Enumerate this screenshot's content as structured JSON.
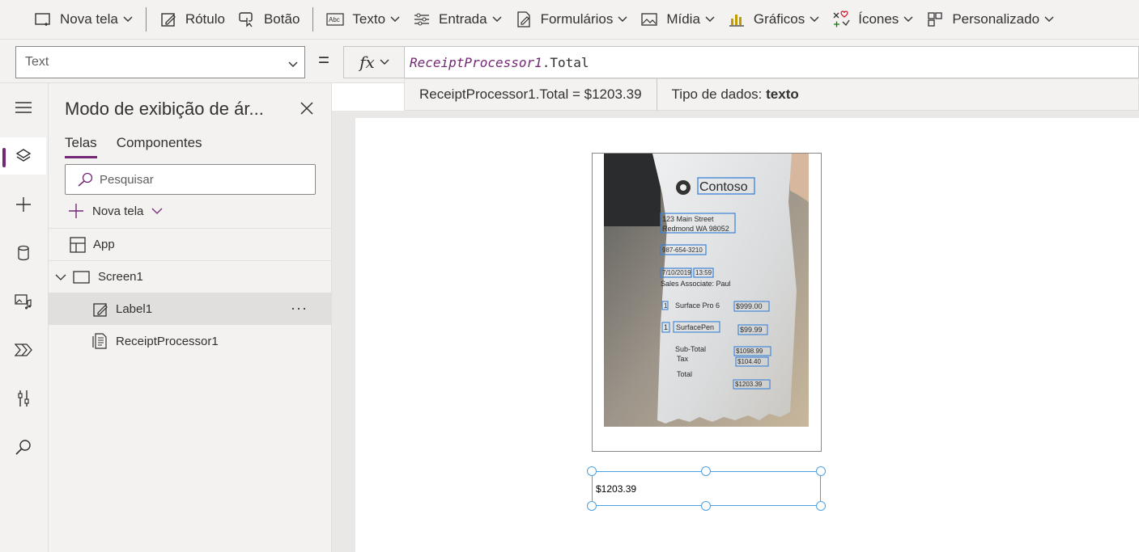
{
  "toolbar": {
    "items": [
      {
        "label": "Nova tela",
        "icon": "new-screen-icon"
      },
      {
        "label": "Rótulo",
        "icon": "label-icon"
      },
      {
        "label": "Botão",
        "icon": "button-icon"
      },
      {
        "label": "Texto",
        "icon": "text-icon"
      },
      {
        "label": "Entrada",
        "icon": "input-icon"
      },
      {
        "label": "Formulários",
        "icon": "forms-icon"
      },
      {
        "label": "Mídia",
        "icon": "media-icon"
      },
      {
        "label": "Gráficos",
        "icon": "charts-icon"
      },
      {
        "label": "Ícones",
        "icon": "icons-icon"
      },
      {
        "label": "Personalizado",
        "icon": "custom-icon"
      }
    ]
  },
  "formula": {
    "property": "Text",
    "equals": "=",
    "fx": "fx",
    "identifier": "ReceiptProcessor1",
    "member": ".Total",
    "result_expr": "ReceiptProcessor1.Total  =  $1203.39",
    "type_label": "Tipo de dados:",
    "type_value": "texto"
  },
  "panel": {
    "title": "Modo de exibição de ár...",
    "tabs": [
      "Telas",
      "Componentes"
    ],
    "search_placeholder": "Pesquisar",
    "new_screen": "Nova tela",
    "tree": {
      "app": "App",
      "screen": "Screen1",
      "label": "Label1",
      "receipt": "ReceiptProcessor1",
      "more": "···"
    }
  },
  "canvas": {
    "label_text": "$1203.39",
    "receipt": {
      "brand": "Contoso",
      "addr1": "123 Main Street",
      "addr2": "Redmond WA 98052",
      "phone": "987-654-3210",
      "date": "7/10/2019",
      "time": "13:59",
      "associate": "Sales Associate: Paul",
      "line1_qty": "1",
      "line1_item": "Surface Pro 6",
      "line1_price": "$999.00",
      "line2_qty": "1",
      "line2_item": "SurfacePen",
      "line2_price": "$99.99",
      "subtotal_label": "Sub-Total",
      "subtotal": "$1098.99",
      "tax_label": "Tax",
      "tax": "$104.40",
      "total_label": "Total",
      "total": "$1203.39"
    }
  },
  "colors": {
    "accent": "#742774",
    "selection": "#4ba0e1"
  }
}
